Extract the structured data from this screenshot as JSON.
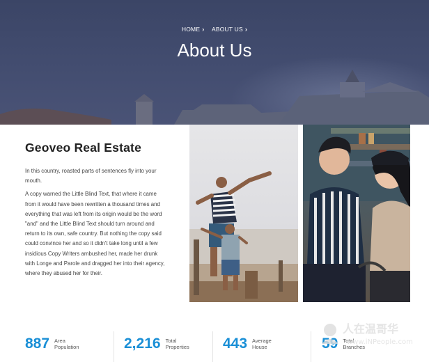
{
  "breadcrumb": [
    {
      "label": "HOME"
    },
    {
      "label": "ABOUT US"
    }
  ],
  "hero": {
    "title": "About Us"
  },
  "about": {
    "heading": "Geoveo Real Estate",
    "paragraphs": [
      "In this country, roasted parts of sentences fly into your mouth.",
      "A copy warned the Little Blind Text, that where it came from it would have been rewritten a thousand times and everything that was left from its origin would be the word \"and\" and the Little Blind Text should turn around and return to its own, safe country. But nothing the copy said could convince her and so it didn't take long until a few insidious Copy Writers ambushed her, made her drunk with Longe and Parole and dragged her into their agency, where they abused her for their."
    ]
  },
  "stats": [
    {
      "value": "887",
      "label_line1": "Area",
      "label_line2": "Population"
    },
    {
      "value": "2,216",
      "label_line1": "Total",
      "label_line2": "Properties"
    },
    {
      "value": "443",
      "label_line1": "Average",
      "label_line2": "House"
    },
    {
      "value": "59",
      "label_line1": "Total",
      "label_line2": "Branches"
    }
  ],
  "watermark": {
    "text_cn": "人在温哥华",
    "text_url": "www.iNPeople.com"
  },
  "colors": {
    "hero_bg": "#3f4a6c",
    "accent_blue": "#1a8fd6",
    "heading": "#222222"
  }
}
